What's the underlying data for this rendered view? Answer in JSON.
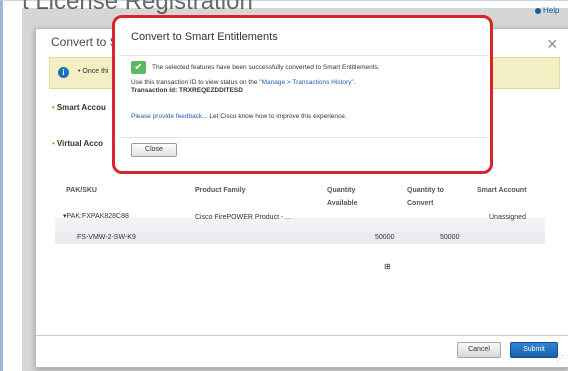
{
  "background": {
    "page_title": "t License Registration",
    "help_label": "Help"
  },
  "dialog": {
    "title": "Convert to S",
    "close_glyph": "×",
    "banner_text": "• Once thi",
    "smart_account_label": "Smart Accou",
    "virtual_account_label": "Virtual Acco",
    "table": {
      "headers": {
        "pak_sku": "PAK/SKU",
        "product_family": "Product Family",
        "quantity_available": "Quantity Available",
        "quantity_to_convert": "Quantity to Convert",
        "smart_account": "Smart Account"
      },
      "rows": [
        {
          "pak_sku": "▾PAK:FXPAK828C88",
          "product_family": "Cisco FirePOWER Product - ...",
          "quantity_available": "",
          "quantity_to_convert": "",
          "smart_account": "Unassigned"
        },
        {
          "pak_sku": "FS-VMW-2-SW-K9",
          "product_family": "",
          "quantity_available": "50000",
          "quantity_to_convert": "50000",
          "smart_account": ""
        }
      ]
    },
    "buttons": {
      "cancel": "Cancel",
      "submit": "Submit"
    }
  },
  "modal": {
    "title": "Convert to Smart Entitlements",
    "success_message": "The selected features have been successfully converted to Smart Entitlements.",
    "info_prefix": "Use this transaction ID to view status on the ",
    "info_link": "\"Manage > Transactions History\"",
    "info_suffix": ".",
    "transaction_id": "Transaction Id: TRXREQEZDDITESD",
    "feedback_link": "Please provide feedback...",
    "feedback_text": " Let Cisco know how to improve this experience.",
    "close_button": "Close"
  },
  "colors": {
    "modal_border": "#d7252b",
    "link": "#1f5fb0",
    "submit": "#1a5fa6",
    "success": "#5cb85c"
  }
}
